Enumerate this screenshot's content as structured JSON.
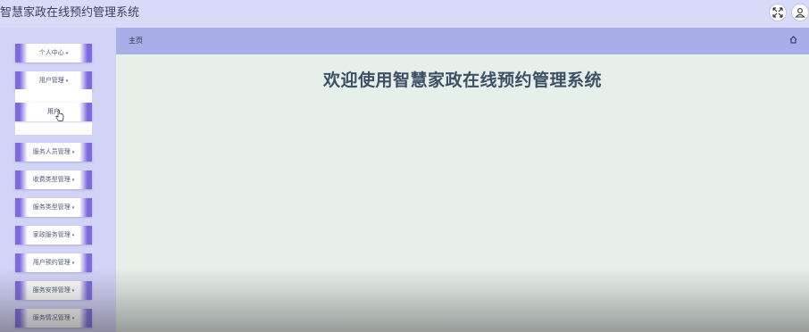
{
  "app": {
    "title": "智慧家政在线预约管理系统"
  },
  "topbar": {
    "icons": [
      "fullscreen-icon",
      "user-icon"
    ]
  },
  "sidebar": {
    "items": [
      {
        "label": "个人中心",
        "caret": "▾"
      },
      {
        "label": "用户管理",
        "caret": "▾",
        "expanded": true,
        "children": [
          {
            "label": "用户"
          }
        ]
      },
      {
        "label": "服务人员管理",
        "caret": "▾"
      },
      {
        "label": "收费类型管理",
        "caret": "▾"
      },
      {
        "label": "服务类型管理",
        "caret": "▾"
      },
      {
        "label": "家政服务管理",
        "caret": "▾"
      },
      {
        "label": "用户预约管理",
        "caret": "▾"
      },
      {
        "label": "服务安排管理",
        "caret": "▾"
      },
      {
        "label": "服务情况管理",
        "caret": "▾"
      }
    ]
  },
  "breadcrumb": {
    "current": "主页"
  },
  "main": {
    "welcome": "欢迎使用智慧家政在线预约管理系统"
  },
  "colors": {
    "header_bg": "#d8dbf7",
    "sidebar_bg": "#d2d4f7",
    "accent": "#7e6ae0",
    "breadcrumb_bg": "#a9ade8",
    "content_bg": "#e6efea",
    "welcome_text": "#3c4f64"
  }
}
